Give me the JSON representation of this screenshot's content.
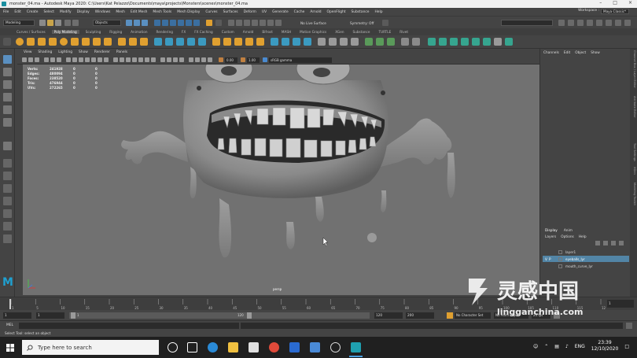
{
  "window": {
    "title": "monster_04.ma - Autodesk Maya 2020: C:\\Users\\Kat Pelazzo\\Documents\\maya\\projects\\Monsters\\scenes\\monster_04.ma"
  },
  "menubar": {
    "items": [
      "File",
      "Edit",
      "Create",
      "Select",
      "Modify",
      "Display",
      "Windows",
      "Mesh",
      "Edit Mesh",
      "Mesh Tools",
      "Mesh Display",
      "Curves",
      "Surfaces",
      "Deform",
      "UV",
      "Generate",
      "Cache",
      "Arnold",
      "OpenFlight",
      "Substance",
      "Help"
    ],
    "workspace_label": "Workspace :",
    "workspace_value": "Maya Classic*"
  },
  "statusline": {
    "mode_menu": "Modeling",
    "objects_menu": "Objects",
    "no_live_surface": "No Live Surface",
    "symmetry": "Symmetry: Off"
  },
  "shelf_tabs": {
    "items": [
      "Curves / Surfaces",
      "Poly Modeling",
      "Sculpting",
      "Rigging",
      "Animation",
      "Rendering",
      "FX",
      "FX Caching",
      "Custom",
      "Arnold",
      "Bifrost",
      "MASH",
      "Motion Graphics",
      "XGen",
      "Substance",
      "TURTLE",
      "Rivet"
    ],
    "active_index": 1
  },
  "panel": {
    "menu": [
      "View",
      "Shading",
      "Lighting",
      "Show",
      "Renderer",
      "Panels"
    ],
    "exposure": "0.00",
    "gamma": "1.00",
    "color_space": "sRGB gamma",
    "camera": "persp"
  },
  "hud": {
    "rows": [
      {
        "label": "Verts:",
        "value": "241928",
        "sel": "0",
        "comp": "0"
      },
      {
        "label": "Edges:",
        "value": "480094",
        "sel": "0",
        "comp": "0"
      },
      {
        "label": "Faces:",
        "value": "238520",
        "sel": "0",
        "comp": "0"
      },
      {
        "label": "Tris:",
        "value": "476944",
        "sel": "0",
        "comp": "0"
      },
      {
        "label": "UVs:",
        "value": "272265",
        "sel": "0",
        "comp": "0"
      }
    ]
  },
  "channel_box": {
    "menu": [
      "Channels",
      "Edit",
      "Object",
      "Show"
    ]
  },
  "layer_editor": {
    "tabs": [
      "Display",
      "Anim"
    ],
    "menu": [
      "Layers",
      "Options",
      "Help"
    ],
    "layers": [
      {
        "name": "layer1",
        "v": "",
        "p": ""
      },
      {
        "name": "eyeballs_lyr",
        "v": "V",
        "p": "P"
      },
      {
        "name": "mouth_curve_lyr",
        "v": "",
        "p": ""
      }
    ],
    "selected_index": 1
  },
  "side_tabs": [
    "Channel Box / Layer Editor",
    "Attribute Editor",
    "Tool Settings",
    "XGen",
    "Modeling Toolkit"
  ],
  "timeslider": {
    "ticks": [
      "1",
      "5",
      "10",
      "15",
      "20",
      "25",
      "30",
      "35",
      "40",
      "45",
      "50",
      "55",
      "60",
      "65",
      "70",
      "75",
      "80",
      "85",
      "90",
      "95",
      "100",
      "105",
      "110",
      "115",
      "120"
    ],
    "current_frame": "1"
  },
  "rangeslider": {
    "start": "1",
    "inner_start": "1",
    "range_label_left": "1",
    "range_label_right": "120",
    "inner_end": "120",
    "end": "200",
    "no_character_set": "No Character Set",
    "no_anim_layer": "No Anim Layer",
    "fps": "24 fps"
  },
  "cmdline": {
    "label": "MEL"
  },
  "helpline": {
    "text": "Select Tool: select an object"
  },
  "taskbar": {
    "search_placeholder": "Type here to search",
    "language": "ENG",
    "time": "23:39",
    "date": "12/10/2020"
  },
  "watermark": {
    "cn": "灵感中国",
    "url": "lingganchina.com"
  },
  "colors": {
    "ui_bg": "#444444",
    "viewport_bg": "#717171",
    "accent_blue": "#5285a6",
    "shelf_yellow": "#e0a030",
    "shelf_teal": "#36a58f",
    "taskbar": "#202020"
  }
}
